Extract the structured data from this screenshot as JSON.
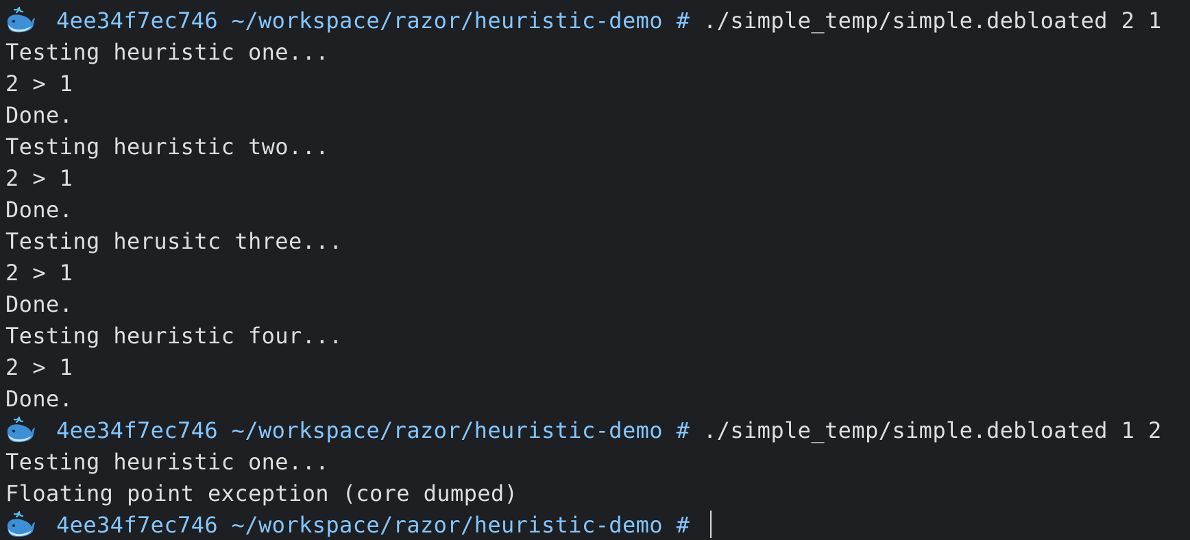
{
  "terminal": {
    "colors": {
      "background": "#1d1f22",
      "text": "#dedede",
      "prompt": "#84c6ff"
    },
    "clipped_top_line": {
      "icon": "whale-icon",
      "text_a": "   ",
      "text_b": "       ",
      "text_c": "                                                                         "
    },
    "prompt": {
      "icon": "whale-icon",
      "host": "4ee34f7ec746",
      "path": "~/workspace/razor/heuristic-demo",
      "symbol": "#"
    },
    "entries": [
      {
        "command": "./simple_temp/simple.debloated 2 1",
        "output": [
          "Testing heuristic one...",
          "2 > 1",
          "Done.",
          "Testing heuristic two...",
          "2 > 1",
          "Done.",
          "Testing herusitc three...",
          "2 > 1",
          "Done.",
          "Testing heuristic four...",
          "2 > 1",
          "Done."
        ]
      },
      {
        "command": "./simple_temp/simple.debloated 1 2",
        "output": [
          "Testing heuristic one...",
          "Floating point exception (core dumped)"
        ]
      }
    ],
    "current_input": ""
  }
}
